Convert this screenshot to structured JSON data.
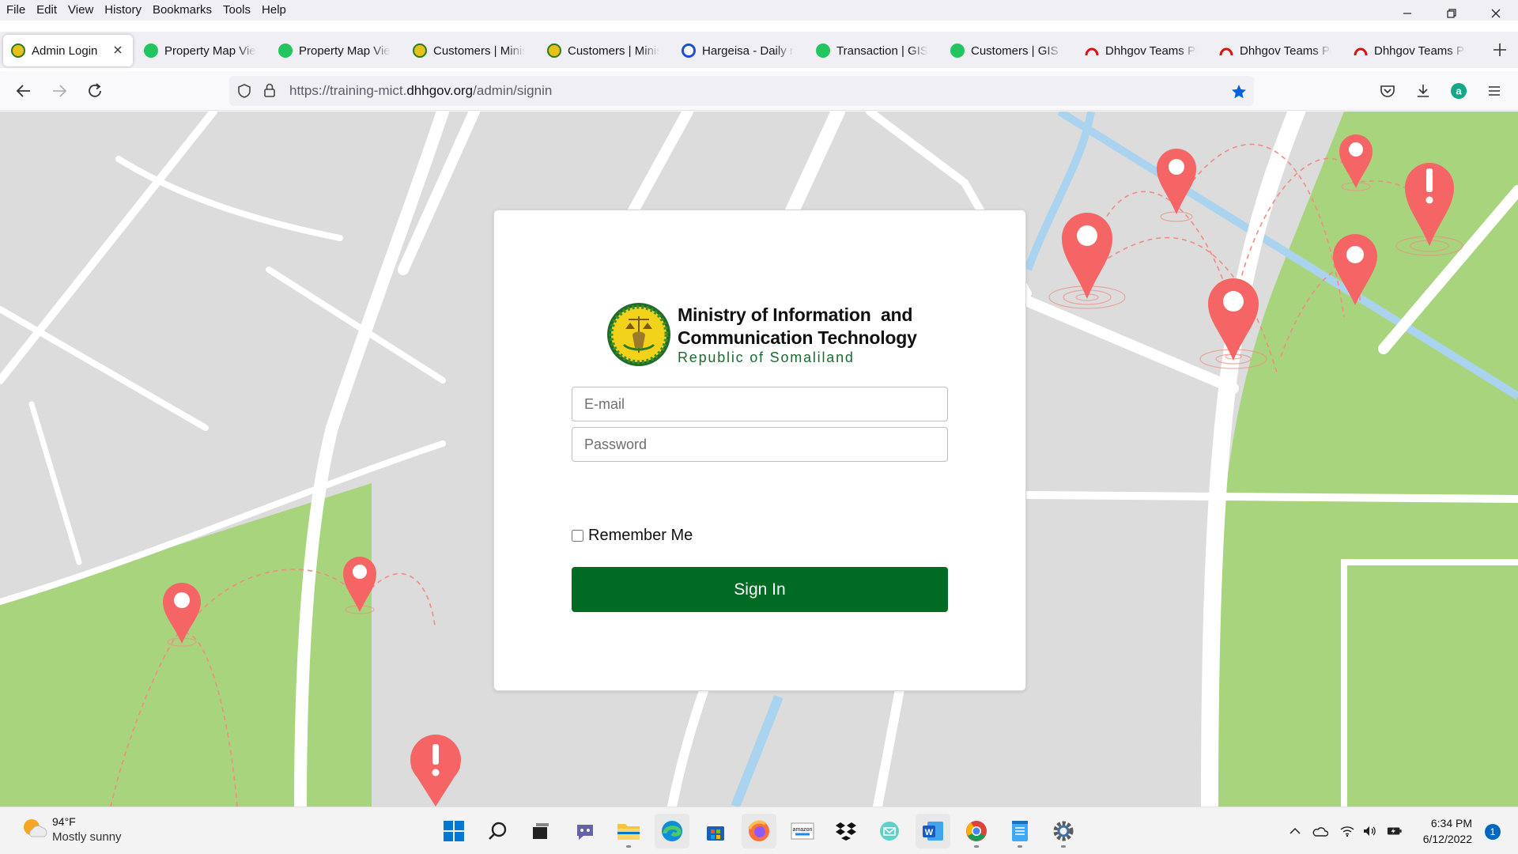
{
  "menubar": {
    "items": [
      "File",
      "Edit",
      "View",
      "History",
      "Bookmarks",
      "Tools",
      "Help"
    ]
  },
  "tabs": [
    {
      "title": "Admin Login",
      "icon": "ministry-emblem-icon",
      "active": true
    },
    {
      "title": "Property Map Vie",
      "icon": "green-globe-icon"
    },
    {
      "title": "Property Map Vie",
      "icon": "green-globe-icon"
    },
    {
      "title": "Customers | Minis",
      "icon": "ministry-emblem-icon"
    },
    {
      "title": "Customers | Minis",
      "icon": "ministry-emblem-icon"
    },
    {
      "title": "Hargeisa - Daily r",
      "icon": "blue-clock-icon"
    },
    {
      "title": "Transaction | GIS I",
      "icon": "green-globe-icon"
    },
    {
      "title": "Customers | GIS P",
      "icon": "green-globe-icon"
    },
    {
      "title": "Dhhgov Teams Po",
      "icon": "red-arch-icon"
    },
    {
      "title": "Dhhgov Teams Po",
      "icon": "red-arch-icon"
    },
    {
      "title": "Dhhgov Teams Po",
      "icon": "red-arch-icon"
    }
  ],
  "urlbar": {
    "prefix": "https://training-mict.",
    "host": "dhhgov.org",
    "path": "/admin/signin"
  },
  "login": {
    "org_line1": "Ministry of Information  and",
    "org_line2": "Communication Technology",
    "org_sub": "Republic of Somaliland",
    "email_placeholder": "E-mail",
    "email_value": "",
    "password_placeholder": "Password",
    "password_value": "",
    "remember_label": "Remember Me",
    "remember_checked": false,
    "signin_label": "Sign In",
    "signin_color": "#006b22"
  },
  "taskbar": {
    "weather_temp": "94°F",
    "weather_cond": "Mostly sunny",
    "apps": [
      "start-button",
      "search-button",
      "task-view-button",
      "teams-chat-icon",
      "file-explorer-icon",
      "edge-icon",
      "store-icon",
      "firefox-icon",
      "amazon-icon",
      "dropbox-icon",
      "mail-icon",
      "word-icon",
      "chrome-icon",
      "notepad-icon",
      "settings-icon"
    ],
    "time": "6:34 PM",
    "date": "6/12/2022",
    "notification_count": "1"
  },
  "colors": {
    "map_background": "#dcdcdc",
    "park_green": "#a9d47e",
    "road_white": "#ffffff",
    "water_blue": "#aad3f0",
    "pin_red": "#f56565"
  }
}
